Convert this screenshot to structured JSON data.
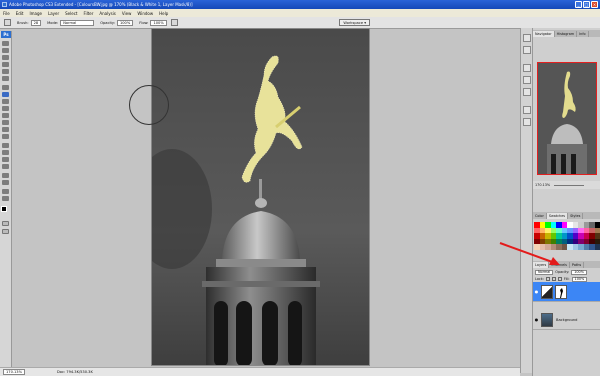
{
  "app": {
    "title": "Adobe Photoshop CS3 Extended - [ColoursBW.jpg @ 170% (Black & White 1, Layer Mask/8)]",
    "window_buttons": {
      "minimize": "_",
      "maximize": "□",
      "close": "×"
    }
  },
  "menu": [
    "File",
    "Edit",
    "Image",
    "Layer",
    "Select",
    "Filter",
    "Analysis",
    "View",
    "Window",
    "Help"
  ],
  "options": {
    "brush_label": "Brush:",
    "brush_size": "28",
    "mode_label": "Mode:",
    "mode_value": "Normal",
    "opacity_label": "Opacity:",
    "opacity_value": "100%",
    "flow_label": "Flow:",
    "flow_value": "100%",
    "workspace": "Workspace ▾"
  },
  "toolbox": {
    "badge": "Ps"
  },
  "status": {
    "zoom": "170.13%",
    "doc": "Doc: 794.3K/530.3K"
  },
  "panels": {
    "navigator_tabs": [
      "Navigator",
      "Histogram",
      "Info"
    ],
    "navigator_zoom": "170.13%",
    "swatches_tabs": [
      "Color",
      "Swatches",
      "Styles"
    ],
    "layers_tabs": [
      "Layers",
      "Channels",
      "Paths"
    ],
    "blend_mode": "Normal",
    "opacity_label": "Opacity:",
    "opacity_value": "100%",
    "lock_label": "Lock:",
    "fill_label": "Fill:",
    "fill_value": "100%",
    "layers": [
      {
        "name": "",
        "selected": true
      },
      {
        "name": "Background",
        "selected": false
      }
    ]
  },
  "colors": {
    "accent_arrow": "#e31b1b",
    "layer_selected": "#3c86f5",
    "selection_fill": "#e8e29a"
  },
  "swatch_colors": [
    "#ff0000",
    "#ffff00",
    "#00ff00",
    "#00ffff",
    "#0000ff",
    "#ff00ff",
    "#ffffff",
    "#e6e6e6",
    "#cccccc",
    "#999999",
    "#666666",
    "#000000",
    "#ff6464",
    "#ffb464",
    "#fff064",
    "#96ff64",
    "#64ffc8",
    "#64c8ff",
    "#6496ff",
    "#9664ff",
    "#ff64f0",
    "#ff64a0",
    "#c86464",
    "#a07850",
    "#c80000",
    "#c86400",
    "#c8b400",
    "#64c800",
    "#00c896",
    "#0096c8",
    "#0050c8",
    "#5000c8",
    "#c800b4",
    "#c80050",
    "#800000",
    "#503214",
    "#800000",
    "#804000",
    "#807800",
    "#408000",
    "#008060",
    "#006080",
    "#003080",
    "#300080",
    "#800070",
    "#800030",
    "#400000",
    "#281808",
    "#f5d2b4",
    "#e6beaa",
    "#d2aa96",
    "#b48c78",
    "#8c6e5a",
    "#6e5546",
    "#c8e6f5",
    "#a0c8e6",
    "#78aad2",
    "#507daa",
    "#32558c",
    "#1e3250"
  ]
}
